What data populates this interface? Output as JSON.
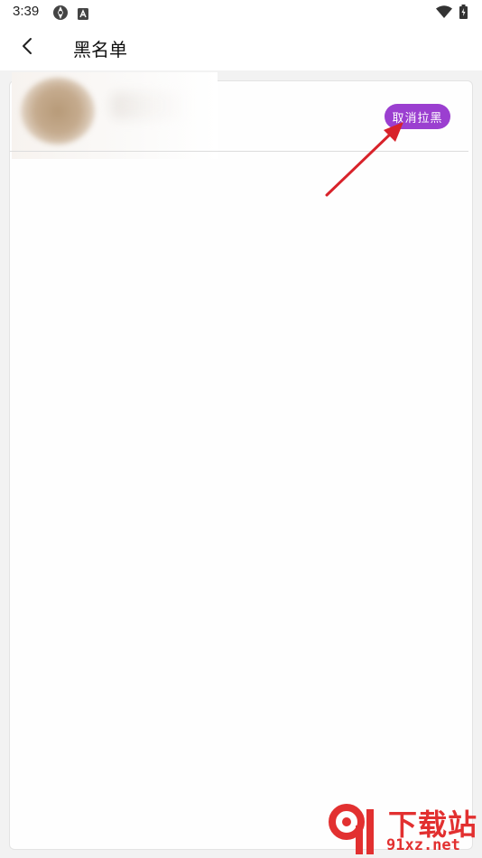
{
  "status_bar": {
    "time": "3:39",
    "icons": [
      "settings-icon",
      "accessibility-badge-icon",
      "wifi-icon",
      "battery-icon"
    ]
  },
  "app_bar": {
    "title": "黑名单",
    "back_icon": "chevron-left-icon"
  },
  "blocked_list": {
    "items": [
      {
        "unblock_label": "取消拉黑"
      }
    ]
  },
  "colors": {
    "accent": "#9b3fd0",
    "annotation": "#d8222a",
    "watermark": "#e23030"
  },
  "watermark": {
    "line1": "下载站",
    "line2": "91xz.net"
  }
}
